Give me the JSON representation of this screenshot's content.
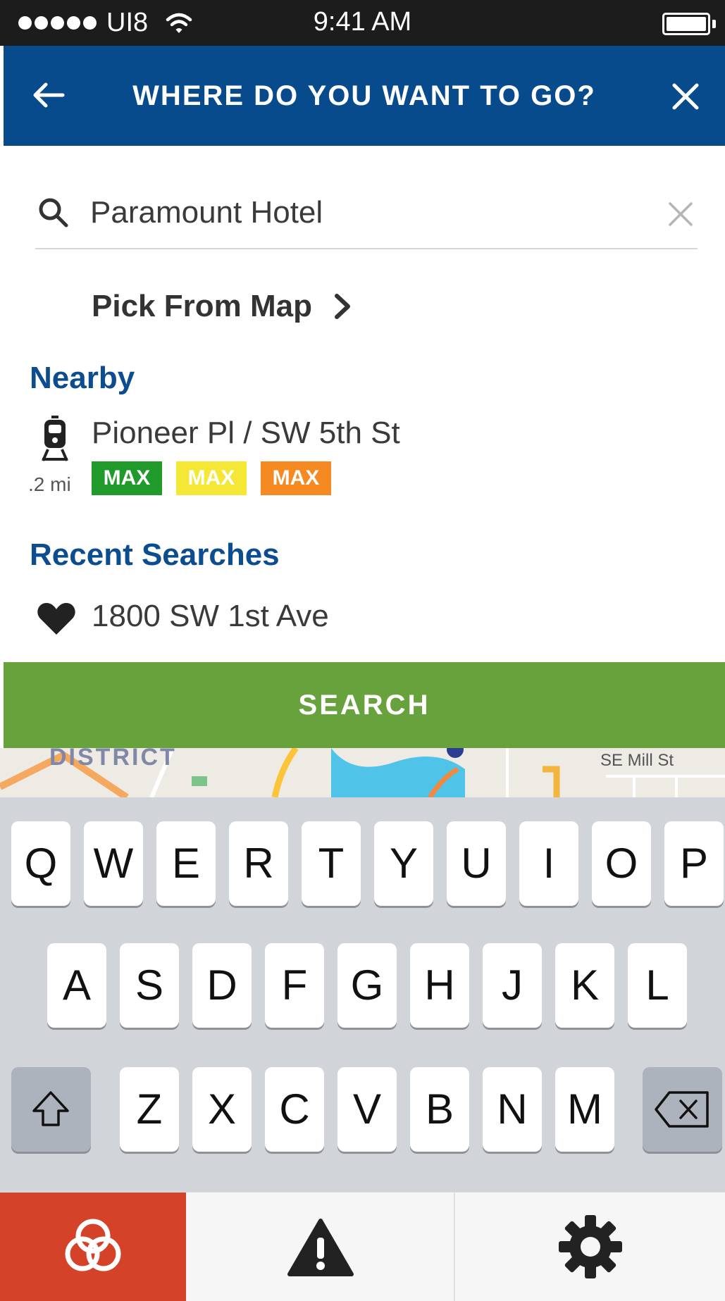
{
  "status_bar": {
    "carrier": "UI8",
    "time": "9:41 AM"
  },
  "header": {
    "title": "WHERE DO YOU WANT TO GO?"
  },
  "search": {
    "value": "Paramount Hotel",
    "placeholder": ""
  },
  "pick_from_map": {
    "label": "Pick From Map"
  },
  "nearby": {
    "heading": "Nearby",
    "stop": {
      "name": "Pioneer Pl / SW 5th St",
      "distance": ".2 mi",
      "lines": [
        {
          "label": "MAX",
          "color": "#1f9a2b"
        },
        {
          "label": "MAX",
          "color": "#f5e735"
        },
        {
          "label": "MAX",
          "color": "#f58a22"
        }
      ]
    }
  },
  "recent": {
    "heading": "Recent Searches",
    "items": [
      "1800 SW 1st Ave"
    ]
  },
  "search_button": {
    "label": "SEARCH"
  },
  "map_peek": {
    "district_label": "DISTRICT",
    "street_label": "SE Mill St"
  },
  "keyboard": {
    "row1": [
      "Q",
      "W",
      "E",
      "R",
      "T",
      "Y",
      "U",
      "I",
      "O",
      "P"
    ],
    "row2": [
      "A",
      "S",
      "D",
      "F",
      "G",
      "H",
      "J",
      "K",
      "L"
    ],
    "row3": [
      "Z",
      "X",
      "C",
      "V",
      "B",
      "N",
      "M"
    ]
  },
  "tab_bar": {
    "items": [
      "home-icon",
      "alert-icon",
      "gear-icon"
    ],
    "active_color": "#d4422a"
  },
  "colors": {
    "header": "#074b8d",
    "heading": "#0c4d90",
    "search_button": "#67a23d"
  }
}
